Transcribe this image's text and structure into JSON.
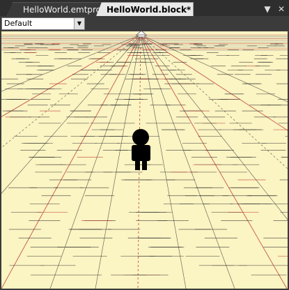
{
  "tabs": [
    {
      "label": "HelloWorld.emtproj",
      "active": false
    },
    {
      "label": "HelloWorld.block*",
      "active": true
    }
  ],
  "tab_controls": {
    "dropdown_icon": "chevron-down-icon",
    "close_icon": "close-icon"
  },
  "toolbar": {
    "layer_select_value": "Default",
    "layer_select_icon": "dropdown-arrow-icon"
  },
  "viewport": {
    "floor_color": "#fbf4c3",
    "horizon_color": "#9a9a9a",
    "grid_color": "#222222",
    "accent_color": "#b22222",
    "character_icon": "player-character-icon",
    "handle_icon": "horizon-handle-icon"
  }
}
